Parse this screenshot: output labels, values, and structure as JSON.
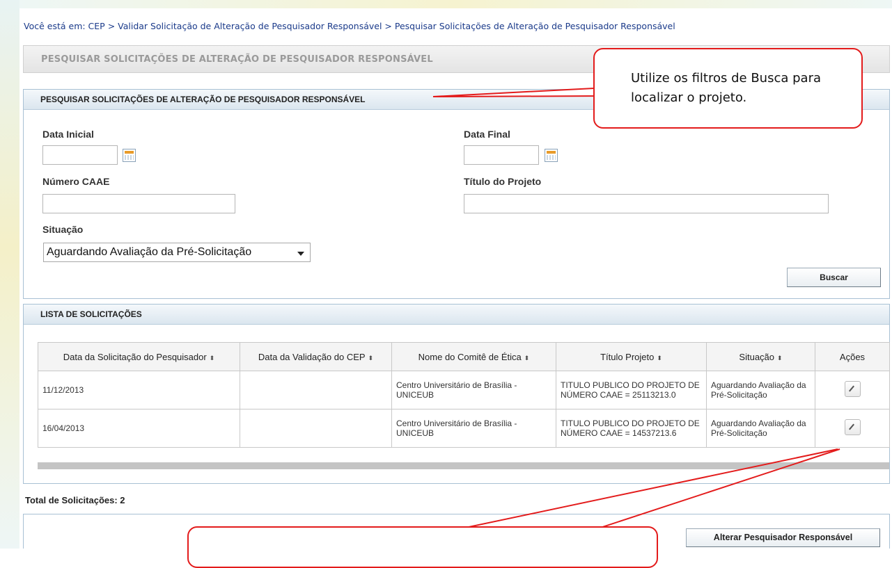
{
  "breadcrumb": "Você está em: CEP > Validar Solicitação de Alteração de Pesquisador Responsável > Pesquisar Solicitações de Alteração de Pesquisador Responsável",
  "page_title": "PESQUISAR SOLICITAÇÕES DE ALTERAÇÃO DE PESQUISADOR RESPONSÁVEL",
  "search_panel": {
    "title": "PESQUISAR SOLICITAÇÕES DE ALTERAÇÃO DE PESQUISADOR RESPONSÁVEL",
    "data_inicial_label": "Data Inicial",
    "data_inicial_value": "",
    "data_final_label": "Data Final",
    "data_final_value": "",
    "numero_caae_label": "Número CAAE",
    "numero_caae_value": "",
    "titulo_projeto_label": "Título do Projeto",
    "titulo_projeto_value": "",
    "situacao_label": "Situação",
    "situacao_selected": "Aguardando Avaliação da Pré-Solicitação",
    "buscar_label": "Buscar"
  },
  "list_panel": {
    "title": "LISTA DE SOLICITAÇÕES",
    "columns": [
      "Data da Solicitação do Pesquisador",
      "Data da Validação do CEP",
      "Nome do Comitê de Ética",
      "Título Projeto",
      "Situação",
      "Ações"
    ],
    "rows": [
      {
        "data_solicitacao": "11/12/2013",
        "data_validacao": "",
        "comite": "Centro Universitário de Brasília - UNICEUB",
        "titulo": "TITULO PUBLICO DO PROJETO DE NÚMERO CAAE = 25113213.0",
        "situacao": "Aguardando Avaliação da Pré-Solicitação"
      },
      {
        "data_solicitacao": "16/04/2013",
        "data_validacao": "",
        "comite": "Centro Universitário de Brasília - UNICEUB",
        "titulo": "TITULO PUBLICO DO PROJETO DE NÚMERO CAAE = 14537213.6",
        "situacao": "Aguardando Avaliação da Pré-Solicitação"
      }
    ]
  },
  "total_label": "Total de Solicitações: 2",
  "alterar_button_label": "Alterar Pesquisador Responsável",
  "callout_text": "Utilize os filtros de Busca para localizar o projeto.",
  "icons": {
    "calendar": "calendar-icon",
    "edit": "pencil-icon",
    "sort": "sort-arrows-icon",
    "dropdown": "chevron-down-icon"
  },
  "colors": {
    "callout_border": "#e31b1b",
    "panel_header": "#dbe6ef",
    "breadcrumb": "#1a3a8a"
  }
}
